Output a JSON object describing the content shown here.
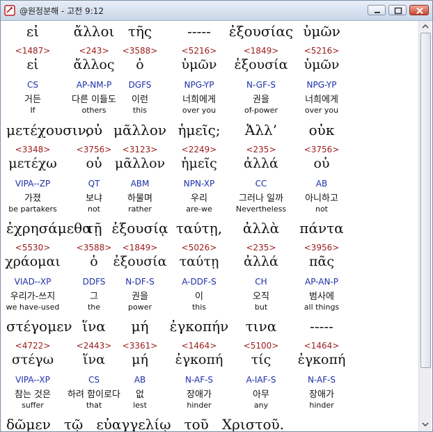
{
  "window": {
    "title": "@원정분해 - 고전 9:12"
  },
  "rows": [
    [
      {
        "greek": "εἰ",
        "strong": "<1487>",
        "lexeme": "εἰ",
        "parse": "CS",
        "korean": "거든",
        "english": "If"
      },
      {
        "greek": "ἄλλοι",
        "strong": "<243>",
        "lexeme": "ἄλλος",
        "parse": "AP-NM-P",
        "korean": "다른 이들도",
        "english": "others"
      },
      {
        "greek": "τῆς",
        "strong": "<3588>",
        "lexeme": "ὁ",
        "parse": "DGFS",
        "korean": "이런",
        "english": "this"
      },
      {
        "greek": "-----",
        "strong": "<5216>",
        "lexeme": "ὑμῶν",
        "parse": "NPG-YP",
        "korean": "너희에게",
        "english": "over you"
      },
      {
        "greek": "ἐξουσίας",
        "strong": "<1849>",
        "lexeme": "ἐξουσία",
        "parse": "N-GF-S",
        "korean": "권을",
        "english": "of-power"
      },
      {
        "greek": "ὑμῶν",
        "strong": "<5216>",
        "lexeme": "ὑμῶν",
        "parse": "NPG-YP",
        "korean": "너희에게",
        "english": "over you"
      }
    ],
    [
      {
        "greek": "μετέχουσιν,",
        "strong": "<3348>",
        "lexeme": "μετέχω",
        "parse": "VIPA--ZP",
        "korean": "가졌",
        "english": "be partakers"
      },
      {
        "greek": "οὐ",
        "strong": "<3756>",
        "lexeme": "οὐ",
        "parse": "QT",
        "korean": "보냐",
        "english": "not"
      },
      {
        "greek": "μᾶλλον",
        "strong": "<3123>",
        "lexeme": "μᾶλλον",
        "parse": "ABM",
        "korean": "하물며",
        "english": "rather"
      },
      {
        "greek": "ἡμεῖς;",
        "strong": "<2249>",
        "lexeme": "ἡμεῖς",
        "parse": "NPN-XP",
        "korean": "우리",
        "english": "are-we"
      },
      {
        "greek": "Ἀλλ’",
        "strong": "<235>",
        "lexeme": "ἀλλά",
        "parse": "CC",
        "korean": "그러나 일까",
        "english": "Nevertheless"
      },
      {
        "greek": "οὐκ",
        "strong": "<3756>",
        "lexeme": "οὐ",
        "parse": "AB",
        "korean": "아니하고",
        "english": "not"
      }
    ],
    [
      {
        "greek": "ἐχρησάμεθα",
        "strong": "<5530>",
        "lexeme": "χράομαι",
        "parse": "VIAD--XP",
        "korean": "우리가-쓰지",
        "english": "we have-used"
      },
      {
        "greek": "τῇ",
        "strong": "<3588>",
        "lexeme": "ὁ",
        "parse": "DDFS",
        "korean": "그",
        "english": "the"
      },
      {
        "greek": "ἐξουσίᾳ",
        "strong": "<1849>",
        "lexeme": "ἐξουσία",
        "parse": "N-DF-S",
        "korean": "권을",
        "english": "power"
      },
      {
        "greek": "ταύτῃ,",
        "strong": "<5026>",
        "lexeme": "ταύτῃ",
        "parse": "A-DDF-S",
        "korean": "이",
        "english": "this"
      },
      {
        "greek": "ἀλλὰ",
        "strong": "<235>",
        "lexeme": "ἀλλά",
        "parse": "CH",
        "korean": "오직",
        "english": "but"
      },
      {
        "greek": "πάντα",
        "strong": "<3956>",
        "lexeme": "πᾶς",
        "parse": "AP-AN-P",
        "korean": "범사에",
        "english": "all things"
      }
    ],
    [
      {
        "greek": "στέγομεν",
        "strong": "<4722>",
        "lexeme": "στέγω",
        "parse": "VIPA--XP",
        "korean": "참는 것은",
        "english": "suffer"
      },
      {
        "greek": "ἵνα",
        "strong": "<2443>",
        "lexeme": "ἵνα",
        "parse": "CS",
        "korean": "하려 함이로다",
        "english": "that"
      },
      {
        "greek": "μή",
        "strong": "<3361>",
        "lexeme": "μή",
        "parse": "AB",
        "korean": "없",
        "english": "lest"
      },
      {
        "greek": "ἐγκοπήν",
        "strong": "<1464>",
        "lexeme": "ἐγκοπή",
        "parse": "N-AF-S",
        "korean": "장애가",
        "english": "hinder"
      },
      {
        "greek": "τινα",
        "strong": "<5100>",
        "lexeme": "τίς",
        "parse": "A-IAF-S",
        "korean": "아무",
        "english": "any"
      },
      {
        "greek": "-----",
        "strong": "<1464>",
        "lexeme": "ἐγκοπή",
        "parse": "N-AF-S",
        "korean": "장애가",
        "english": "hinder"
      }
    ]
  ],
  "partial_line": {
    "text": "δῶμεν   τῷ   εὐαγγελίῳ   τοῦ   Χριστοῦ."
  },
  "colors": {
    "strong_number": "#9c1a1a",
    "parsing_code": "#1c2fa8",
    "text": "#111111"
  }
}
